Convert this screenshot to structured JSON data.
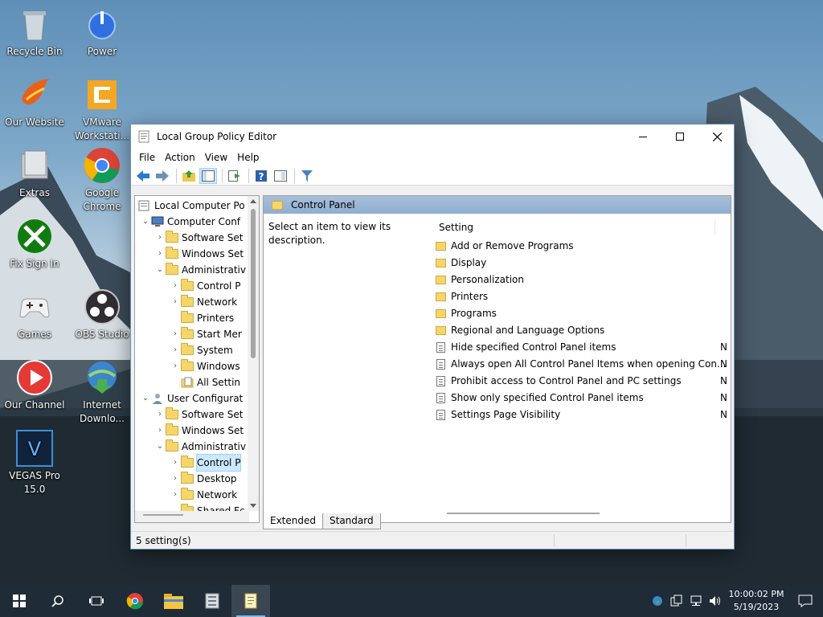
{
  "desktop": {
    "icons": [
      {
        "label": "Recycle Bin"
      },
      {
        "label": "Power"
      },
      {
        "label": "Our Website"
      },
      {
        "label": "VMware Workstati..."
      },
      {
        "label": "Extras"
      },
      {
        "label": "Google Chrome"
      },
      {
        "label": "Fix Sign In"
      },
      {
        "label": "Games"
      },
      {
        "label": "OBS Studio"
      },
      {
        "label": "Our Channel"
      },
      {
        "label": "Internet Downlo..."
      },
      {
        "label": "VEGAS Pro 15.0"
      }
    ]
  },
  "window": {
    "title": "Local Group Policy Editor",
    "menu": [
      "File",
      "Action",
      "View",
      "Help"
    ],
    "tree": [
      {
        "label": "Local Computer Po",
        "arrow": ""
      },
      {
        "label": "Computer Conf",
        "arrow": "v"
      },
      {
        "label": "Software Set",
        "arrow": ">"
      },
      {
        "label": "Windows Set",
        "arrow": ">"
      },
      {
        "label": "Administrativ",
        "arrow": "v"
      },
      {
        "label": "Control P",
        "arrow": ">"
      },
      {
        "label": "Network",
        "arrow": ">"
      },
      {
        "label": "Printers",
        "arrow": ""
      },
      {
        "label": "Start Mer",
        "arrow": ">"
      },
      {
        "label": "System",
        "arrow": ">"
      },
      {
        "label": "Windows",
        "arrow": ">"
      },
      {
        "label": "All Settin",
        "arrow": ""
      },
      {
        "label": "User Configurat",
        "arrow": "v"
      },
      {
        "label": "Software Set",
        "arrow": ">"
      },
      {
        "label": "Windows Set",
        "arrow": ">"
      },
      {
        "label": "Administrativ",
        "arrow": "v"
      },
      {
        "label": "Control P",
        "arrow": ">"
      },
      {
        "label": "Desktop",
        "arrow": ">"
      },
      {
        "label": "Network",
        "arrow": ">"
      },
      {
        "label": "Shared Fc",
        "arrow": ""
      }
    ],
    "pane_header": "Control Panel",
    "description": "Select an item to view its description.",
    "column_setting": "Setting",
    "items": [
      {
        "label": "Add or Remove Programs",
        "state": ""
      },
      {
        "label": "Display",
        "state": ""
      },
      {
        "label": "Personalization",
        "state": ""
      },
      {
        "label": "Printers",
        "state": ""
      },
      {
        "label": "Programs",
        "state": ""
      },
      {
        "label": "Regional and Language Options",
        "state": ""
      },
      {
        "label": "Hide specified Control Panel items",
        "state": "N"
      },
      {
        "label": "Always open All Control Panel Items when opening Con...",
        "state": "N"
      },
      {
        "label": "Prohibit access to Control Panel and PC settings",
        "state": "N"
      },
      {
        "label": "Show only specified Control Panel items",
        "state": "N"
      },
      {
        "label": "Settings Page Visibility",
        "state": "N"
      }
    ],
    "tabs": [
      "Extended",
      "Standard"
    ],
    "status": "5 setting(s)"
  },
  "taskbar": {
    "time": "10:00:02 PM",
    "date": "5/19/2023"
  }
}
